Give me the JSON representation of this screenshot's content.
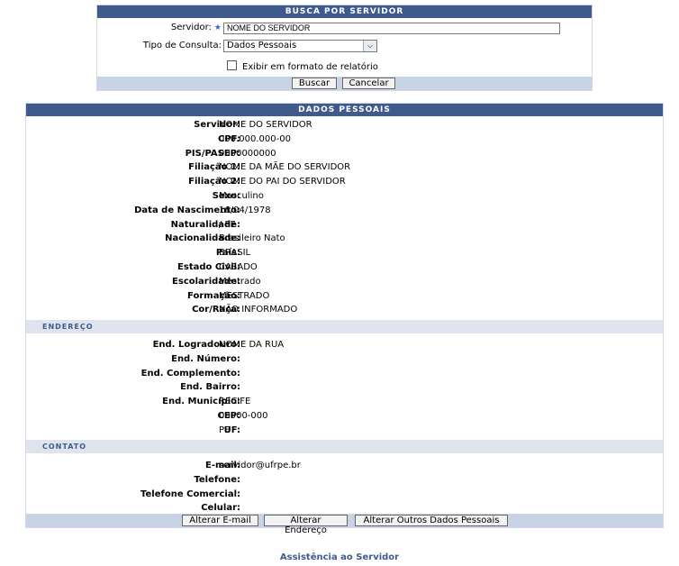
{
  "search": {
    "title": "Busca por Servidor",
    "servidor_label": "Servidor:",
    "servidor_required": "★",
    "servidor_value": "NOME DO SERVIDOR",
    "tipo_label": "Tipo de Consulta:",
    "tipo_value": "Dados Pessoais",
    "relatorio_label": "Exibir em formato de relatório",
    "buscar": "Buscar",
    "cancelar": "Cancelar"
  },
  "dados": {
    "title": "Dados Pessoais",
    "fields": [
      {
        "k": "Servidor:",
        "v": "NOME DO SERVIDOR"
      },
      {
        "k": "CPF:",
        "v": "000.000.000-00"
      },
      {
        "k": "PIS/PASEP:",
        "v": "0000000000"
      },
      {
        "k": "Filiação 1:",
        "v": "NOME DA MÃE DO SERVIDOR"
      },
      {
        "k": "Filiação 2:",
        "v": "NOME DO PAI DO SERVIDOR"
      },
      {
        "k": "Sexo:",
        "v": "Masculino"
      },
      {
        "k": "Data de Nascimento:",
        "v": "16/04/1978"
      },
      {
        "k": "Naturalidade:",
        "v": "/ PE"
      },
      {
        "k": "Nacionalidade:",
        "v": "Brasileiro Nato"
      },
      {
        "k": "País:",
        "v": "BRASIL"
      },
      {
        "k": "Estado Civil:",
        "v": "CASADO"
      },
      {
        "k": "Escolaridade:",
        "v": "Mestrado"
      },
      {
        "k": "Formação:",
        "v": "MESTRADO"
      },
      {
        "k": "Cor/Raça:",
        "v": "NÃO INFORMADO"
      }
    ],
    "endereco_title": "Endereço",
    "endereco": [
      {
        "k": "End. Logradouro:",
        "v": "NOME DA RUA"
      },
      {
        "k": "End. Número:",
        "v": ""
      },
      {
        "k": "End. Complemento:",
        "v": ""
      },
      {
        "k": "End. Bairro:",
        "v": ""
      },
      {
        "k": "End. Município:",
        "v": "RECIFE"
      },
      {
        "k": "CEP:",
        "v": "00000-000"
      },
      {
        "k": "UF:",
        "v": "PE"
      }
    ],
    "contato_title": "Contato",
    "contato": [
      {
        "k": "E-mail:",
        "v": "servidor@ufrpe.br"
      },
      {
        "k": "Telefone:",
        "v": ""
      },
      {
        "k": "Telefone Comercial:",
        "v": ""
      },
      {
        "k": "Celular:",
        "v": ""
      }
    ],
    "btn_email": "Alterar E-mail",
    "btn_endereco": "Alterar Endereço",
    "btn_outros": "Alterar Outros Dados Pessoais"
  },
  "footer": {
    "link": "Assistência ao Servidor"
  }
}
